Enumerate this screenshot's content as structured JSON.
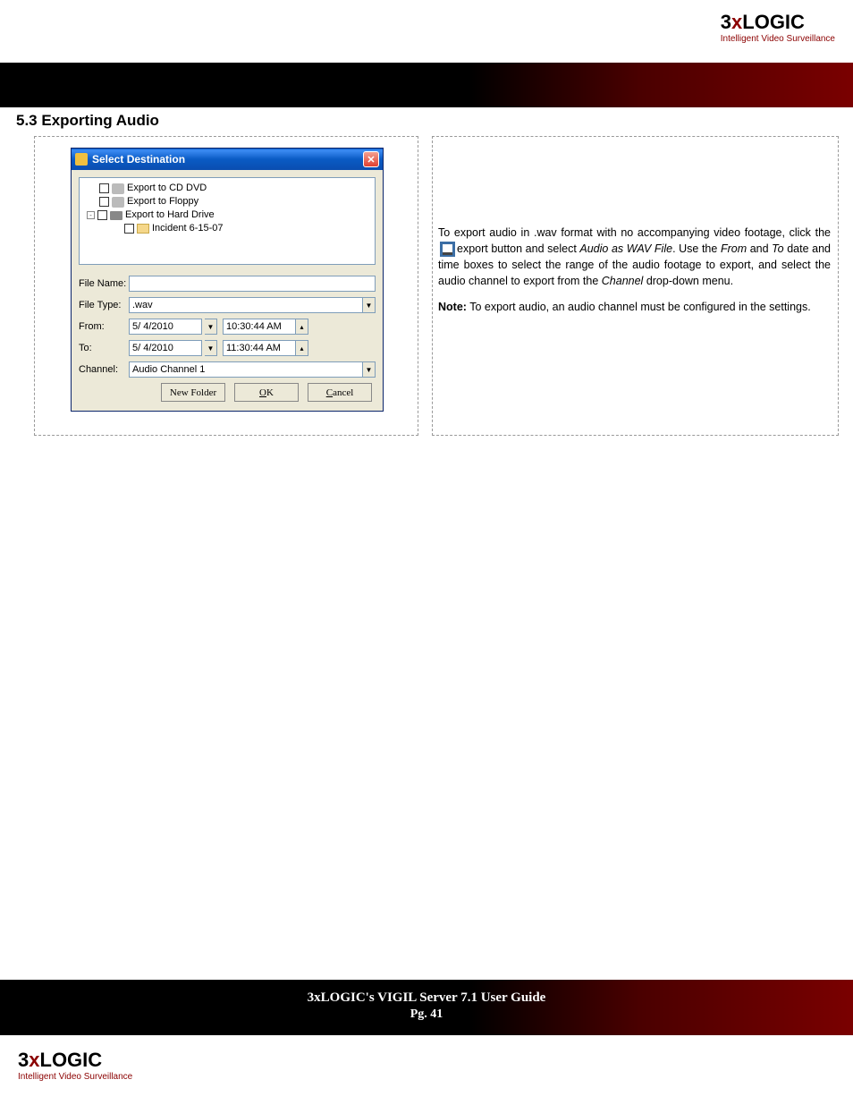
{
  "brand": {
    "logo_pre": "3",
    "logo_x": "x",
    "logo_post": "LOGIC",
    "tagline": "Intelligent Video Surveillance"
  },
  "section_heading": "5.3 Exporting Audio",
  "dialog": {
    "title": "Select Destination",
    "tree": {
      "item1": "Export to CD DVD",
      "item2": "Export to Floppy",
      "item3": "Export to Hard Drive",
      "item4": "Incident 6-15-07"
    },
    "labels": {
      "file_name": "File Name:",
      "file_type": "File Type:",
      "from": "From:",
      "to": "To:",
      "channel": "Channel:"
    },
    "values": {
      "file_name": "",
      "file_type": ".wav",
      "from_date": "5/ 4/2010",
      "from_time": "10:30:44 AM",
      "to_date": "5/ 4/2010",
      "to_time": "11:30:44 AM",
      "channel": "Audio Channel 1"
    },
    "buttons": {
      "new_folder": "New Folder",
      "ok": "OK",
      "cancel": "Cancel"
    }
  },
  "body": {
    "p1_a": "To export audio in .wav format with no accompanying video foot­age, click the ",
    "p1_b": "export button and select ",
    "p1_c": "Audio as WAV File",
    "p1_d": ". Use the ",
    "p1_e": "From",
    "p1_f": " and ",
    "p1_g": "To",
    "p1_h": " date and time boxes to select the range of the audio footage to export, and select the audio channel to export from the ",
    "p1_i": "Channel",
    "p1_j": " drop-down menu.",
    "note_label": "Note:",
    "note_text": " To export audio, an audio channel must be configured in the settings."
  },
  "footer": {
    "title": "3xLOGIC's VIGIL Server 7.1 User Guide",
    "page": "Pg. 41"
  }
}
